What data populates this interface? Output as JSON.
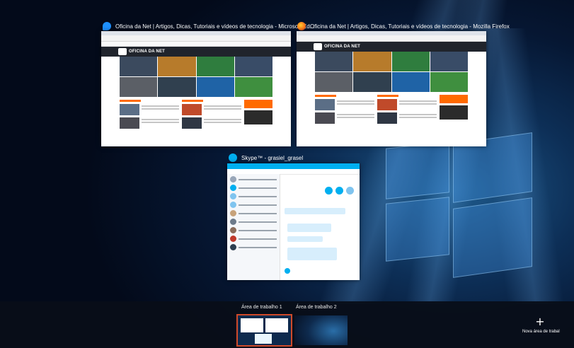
{
  "windows": [
    {
      "title": "Oficina da Net | Artigos, Dicas, Tutoriais e vídeos de tecnologia - Microsoft Ed...",
      "icon": "edge-icon",
      "icon_color": "#1e90ff",
      "site_logo": "OFICINA DA NET"
    },
    {
      "title": "Oficina da Net | Artigos, Dicas, Tutoriais e vídeos de tecnologia - Mozilla Firefox",
      "icon": "firefox-icon",
      "icon_color": "#ff7a1a",
      "site_logo": "OFICINA DA NET"
    },
    {
      "title": "Skype™ - grasiel_grasel",
      "icon": "skype-icon",
      "icon_color": "#00aff0"
    }
  ],
  "desktops": [
    {
      "label": "Área de trabalho 1",
      "active": true
    },
    {
      "label": "Área de trabalho 2",
      "active": false
    }
  ],
  "new_desktop": {
    "icon": "plus-icon",
    "label": "Nova área de trabal"
  },
  "colors": {
    "accent_orange": "#ff6a00",
    "skype_blue": "#00aff0",
    "active_desktop_outline": "#d04a2a"
  }
}
